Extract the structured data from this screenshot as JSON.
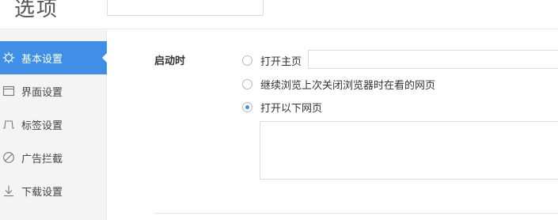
{
  "header": {
    "title": "选项"
  },
  "sidebar": {
    "items": [
      {
        "label": "基本设置",
        "icon": "gear-icon",
        "active": true
      },
      {
        "label": "界面设置",
        "icon": "window-icon",
        "active": false
      },
      {
        "label": "标签设置",
        "icon": "tab-icon",
        "active": false
      },
      {
        "label": "广告拦截",
        "icon": "block-icon",
        "active": false
      },
      {
        "label": "下载设置",
        "icon": "download-icon",
        "active": false
      }
    ]
  },
  "startup": {
    "label": "启动时",
    "options": [
      {
        "label": "打开主页",
        "checked": false
      },
      {
        "label": "继续浏览上次关闭浏览器时在看的网页",
        "checked": false
      },
      {
        "label": "打开以下网页",
        "checked": true
      }
    ],
    "homepage_value": "",
    "pages_value": ""
  },
  "colors": {
    "accent": "#3f8fe6"
  }
}
